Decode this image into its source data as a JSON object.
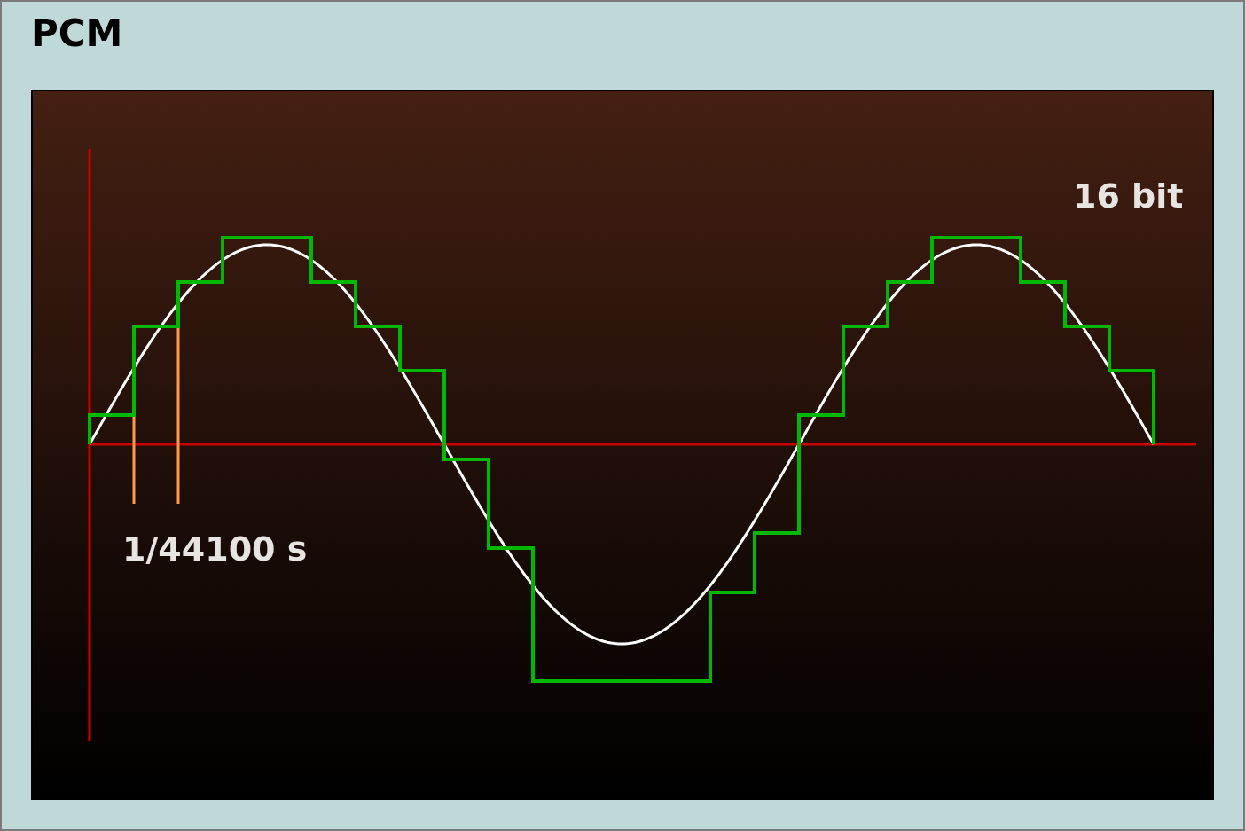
{
  "title": "PCM",
  "diagram": {
    "time_label": "1/44100 s",
    "depth_label": "16 bit"
  }
}
